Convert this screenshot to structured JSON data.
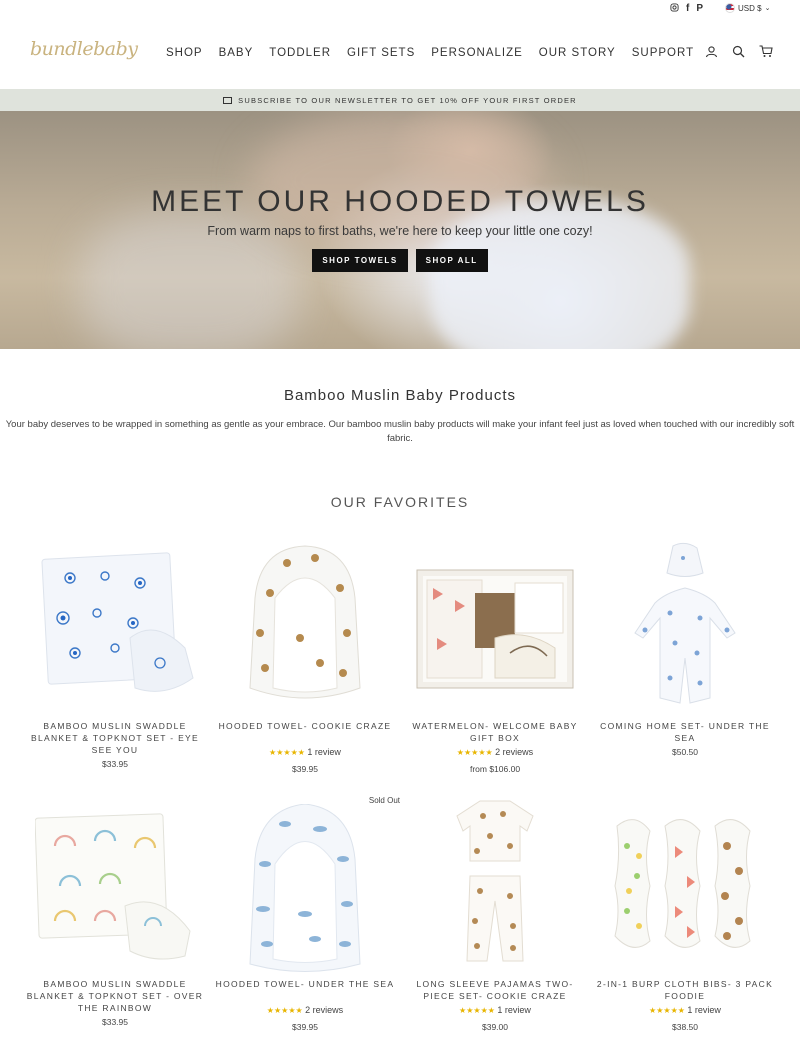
{
  "utility": {
    "social": [
      "instagram-icon",
      "facebook-icon",
      "pinterest-icon"
    ],
    "currency": "USD $"
  },
  "header": {
    "logo": "bundlebaby",
    "nav": [
      "SHOP",
      "BABY",
      "TODDLER",
      "GIFT SETS",
      "PERSONALIZE",
      "OUR STORY",
      "SUPPORT"
    ],
    "icons": [
      "account-icon",
      "search-icon",
      "cart-icon"
    ]
  },
  "announcement": "SUBSCRIBE TO OUR NEWSLETTER TO GET 10% OFF YOUR FIRST ORDER",
  "hero": {
    "title": "MEET OUR HOODED TOWELS",
    "subtitle": "From warm naps to first baths, we're here to keep your little one cozy!",
    "btn_primary": "SHOP TOWELS",
    "btn_secondary": "SHOP ALL"
  },
  "intro": {
    "title": "Bamboo Muslin Baby Products",
    "text": "Your baby deserves to be wrapped in something as gentle as your embrace. Our bamboo muslin baby products will make your infant feel just as loved when touched with our incredibly soft fabric."
  },
  "favorites_title": "OUR FAVORITES",
  "products": [
    {
      "name": "BAMBOO MUSLIN SWADDLE BLANKET & TOPKNOT SET - EYE SEE YOU",
      "rating": "",
      "price": "$33.95",
      "sold_out": ""
    },
    {
      "name": "HOODED TOWEL- COOKIE CRAZE",
      "rating": "1 review",
      "price": "$39.95",
      "sold_out": ""
    },
    {
      "name": "WATERMELON- WELCOME BABY GIFT BOX",
      "rating": "2 reviews",
      "price": "from $106.00",
      "sold_out": ""
    },
    {
      "name": "COMING HOME SET- UNDER THE SEA",
      "rating": "",
      "price": "$50.50",
      "sold_out": ""
    },
    {
      "name": "BAMBOO MUSLIN SWADDLE BLANKET & TOPKNOT SET - OVER THE RAINBOW",
      "rating": "",
      "price": "$33.95",
      "sold_out": ""
    },
    {
      "name": "HOODED TOWEL- UNDER THE SEA",
      "rating": "2 reviews",
      "price": "$39.95",
      "sold_out": "Sold Out"
    },
    {
      "name": "LONG SLEEVE PAJAMAS TWO-PIECE SET- COOKIE CRAZE",
      "rating": "1 review",
      "price": "$39.00",
      "sold_out": ""
    },
    {
      "name": "2-IN-1 BURP CLOTH BIBS- 3 PACK FOODIE",
      "rating": "1 review",
      "price": "$38.50",
      "sold_out": ""
    }
  ],
  "stars": "★★★★★",
  "colors": {
    "announcement_bg": "#dfe3dc",
    "button_bg": "#111111",
    "star": "#e8b500",
    "logo": "#c9b37f"
  }
}
